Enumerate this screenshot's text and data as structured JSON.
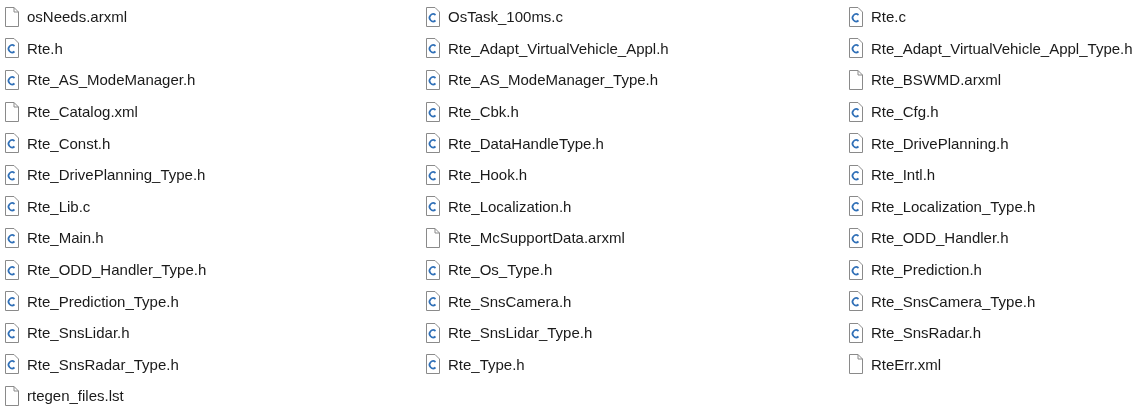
{
  "columns": [
    [
      {
        "name": "osNeeds.arxml",
        "kind": "plain"
      },
      {
        "name": "Rte.h",
        "kind": "c"
      },
      {
        "name": "Rte_AS_ModeManager.h",
        "kind": "c"
      },
      {
        "name": "Rte_Catalog.xml",
        "kind": "plain"
      },
      {
        "name": "Rte_Const.h",
        "kind": "c"
      },
      {
        "name": "Rte_DrivePlanning_Type.h",
        "kind": "c"
      },
      {
        "name": "Rte_Lib.c",
        "kind": "c"
      },
      {
        "name": "Rte_Main.h",
        "kind": "c"
      },
      {
        "name": "Rte_ODD_Handler_Type.h",
        "kind": "c"
      },
      {
        "name": "Rte_Prediction_Type.h",
        "kind": "c"
      },
      {
        "name": "Rte_SnsLidar.h",
        "kind": "c"
      },
      {
        "name": "Rte_SnsRadar_Type.h",
        "kind": "c"
      },
      {
        "name": "rtegen_files.lst",
        "kind": "plain"
      }
    ],
    [
      {
        "name": "OsTask_100ms.c",
        "kind": "c"
      },
      {
        "name": "Rte_Adapt_VirtualVehicle_Appl.h",
        "kind": "c"
      },
      {
        "name": "Rte_AS_ModeManager_Type.h",
        "kind": "c"
      },
      {
        "name": "Rte_Cbk.h",
        "kind": "c"
      },
      {
        "name": "Rte_DataHandleType.h",
        "kind": "c"
      },
      {
        "name": "Rte_Hook.h",
        "kind": "c"
      },
      {
        "name": "Rte_Localization.h",
        "kind": "c"
      },
      {
        "name": "Rte_McSupportData.arxml",
        "kind": "plain"
      },
      {
        "name": "Rte_Os_Type.h",
        "kind": "c"
      },
      {
        "name": "Rte_SnsCamera.h",
        "kind": "c"
      },
      {
        "name": "Rte_SnsLidar_Type.h",
        "kind": "c"
      },
      {
        "name": "Rte_Type.h",
        "kind": "c"
      }
    ],
    [
      {
        "name": "Rte.c",
        "kind": "c"
      },
      {
        "name": "Rte_Adapt_VirtualVehicle_Appl_Type.h",
        "kind": "c"
      },
      {
        "name": "Rte_BSWMD.arxml",
        "kind": "plain"
      },
      {
        "name": "Rte_Cfg.h",
        "kind": "c"
      },
      {
        "name": "Rte_DrivePlanning.h",
        "kind": "c"
      },
      {
        "name": "Rte_Intl.h",
        "kind": "c"
      },
      {
        "name": "Rte_Localization_Type.h",
        "kind": "c"
      },
      {
        "name": "Rte_ODD_Handler.h",
        "kind": "c"
      },
      {
        "name": "Rte_Prediction.h",
        "kind": "c"
      },
      {
        "name": "Rte_SnsCamera_Type.h",
        "kind": "c"
      },
      {
        "name": "Rte_SnsRadar.h",
        "kind": "c"
      },
      {
        "name": "RteErr.xml",
        "kind": "plain"
      }
    ]
  ]
}
